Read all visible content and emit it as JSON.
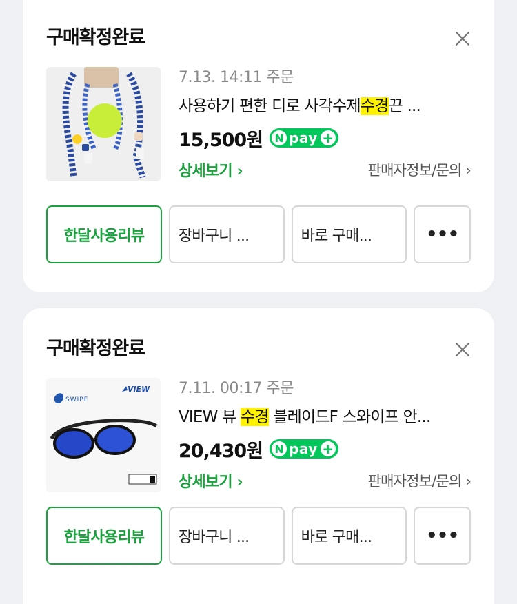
{
  "orders": [
    {
      "status": "구매확정완료",
      "date": "7.13. 14:11 주문",
      "product_name_pre": "사용하기 편한 디로 사각수제",
      "product_name_highlight": "수경",
      "product_name_post": "끈 ...",
      "price": "15,500원",
      "npay": "pay",
      "detail_link": "상세보기 ›",
      "seller_link": "판매자정보/문의 ›",
      "buttons": {
        "review": "한달사용리뷰",
        "cart": "장바구니 ...",
        "buy": "바로 구매...",
        "more": "•••"
      }
    },
    {
      "status": "구매확정완료",
      "date": "7.11. 00:17 주문",
      "product_name_pre": "VIEW 뷰 ",
      "product_name_highlight": "수경",
      "product_name_post": " 블레이드F 스와이프 안...",
      "price": "20,430원",
      "npay": "pay",
      "detail_link": "상세보기 ›",
      "seller_link": "판매자정보/문의 ›",
      "buttons": {
        "review": "한달사용리뷰",
        "cart": "장바구니 ...",
        "buy": "바로 구매...",
        "more": "•••"
      },
      "thumb_text": {
        "brand_top": "VIEW",
        "brand_left": "SWIPE"
      }
    }
  ],
  "colors": {
    "accent_green": "#1ba23f",
    "npay_green": "#03c75a",
    "highlight": "#fff200"
  }
}
